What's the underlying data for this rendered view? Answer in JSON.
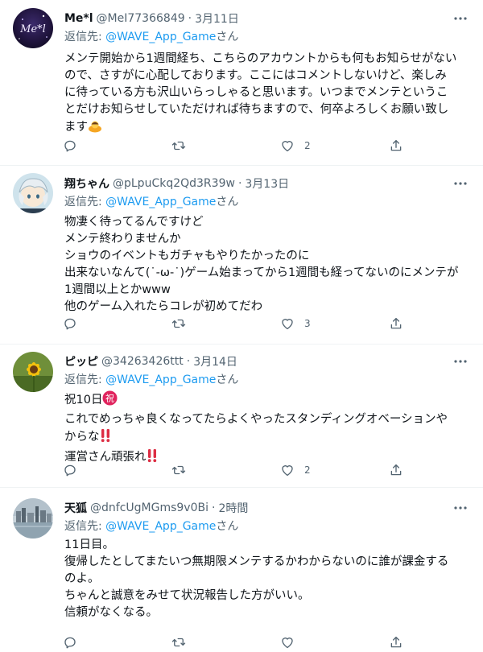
{
  "tweets": [
    {
      "name": "Me*l",
      "handle": "@MeI77366849",
      "dot": "·",
      "time": "3月11日",
      "reply_prefix": "返信先: ",
      "reply_to": "@WAVE_App_Game",
      "reply_suffix": "さん",
      "lines": [
        "メンテ開始から1週間経ち、こちらのアカウントからも何もお知らせがない",
        "ので、さすがに心配しております。ここにはコメントしないけど、楽しみ",
        "に待っている方も沢山いらっしゃると思います。いつまでメンテというこ",
        "とだけお知らせしていただければ待ちますので、何卒よろしくお願い致し",
        "ます"
      ],
      "likes": "2",
      "avatar_text": "Me*l"
    },
    {
      "name": "翔ちゃん",
      "handle": "@pLpuCkq2Qd3R39w",
      "dot": "·",
      "time": "3月13日",
      "reply_prefix": "返信先: ",
      "reply_to": "@WAVE_App_Game",
      "reply_suffix": "さん",
      "lines": [
        "物凄く待ってるんですけど",
        "メンテ終わりませんか",
        "ショウのイベントもガチャもやりたかったのに",
        "出来ないなんて(˙-ω-˙)ゲーム始まってから1週間も経ってないのにメンテが",
        "1週間以上とかwww",
        "他のゲーム入れたらコレが初めてだわ"
      ],
      "likes": "3"
    },
    {
      "name": "ピッピ",
      "handle": "@34263426ttt",
      "dot": "·",
      "time": "3月14日",
      "reply_prefix": "返信先: ",
      "reply_to": "@WAVE_App_Game",
      "reply_suffix": "さん",
      "lines": [
        "祝10日",
        "これでめっちゃ良くなってたらよくやったスタンディングオベーションや",
        "からな",
        "運営さん頑張れ"
      ],
      "celebrate_char": "祝",
      "likes": "2"
    },
    {
      "name": "天狐",
      "handle": "@dnfcUgMGms9v0Bi",
      "dot": "·",
      "time": "2時間",
      "reply_prefix": "返信先: ",
      "reply_to": "@WAVE_App_Game",
      "reply_suffix": "さん",
      "lines": [
        "11日目。",
        "復帰したとしてまたいつ無期限メンテするかわからないのに誰が課金する",
        "のよ。",
        "ちゃんと誠意をみせて状況報告した方がいい。",
        "信頼がなくなる。"
      ]
    }
  ],
  "colors": {
    "text": "#0f1419",
    "muted": "#536471",
    "link": "#1d9bf0",
    "divider": "#eff3f4",
    "exclaim": "#dd2e44"
  },
  "icons": [
    "more-icon",
    "reply-icon",
    "retweet-icon",
    "like-icon",
    "share-icon",
    "bow-emoji",
    "celebrate-emoji",
    "double-exclamation-emoji"
  ]
}
